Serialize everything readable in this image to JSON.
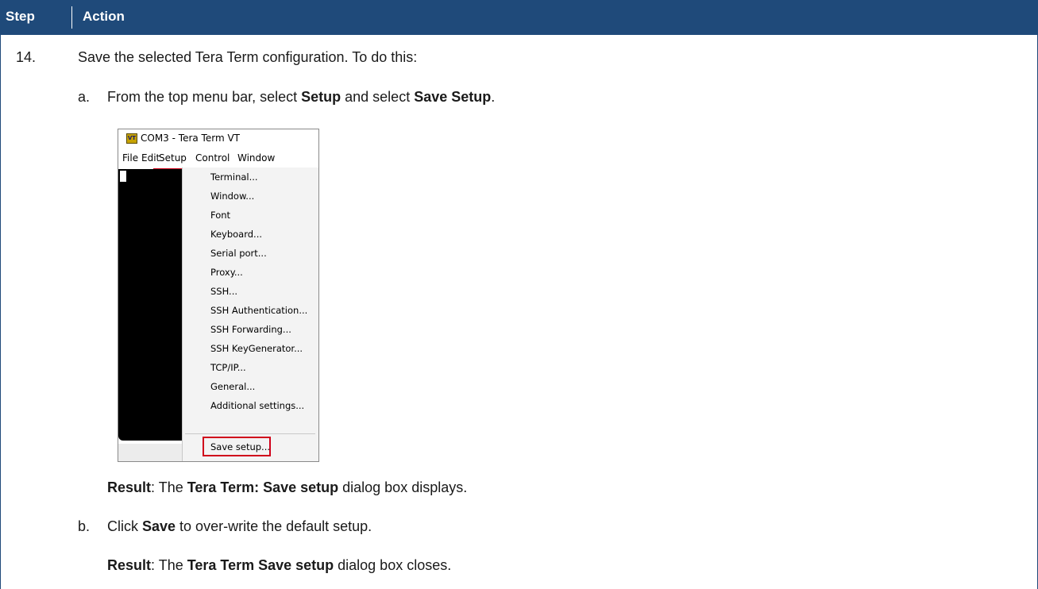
{
  "header": {
    "step_label": "Step",
    "action_label": "Action"
  },
  "step": {
    "number": "14.",
    "intro": "Save the selected Tera Term configuration. To do this:",
    "substeps": [
      {
        "letter": "a.",
        "t1": "From the top menu bar, select ",
        "b1": "Setup",
        "t2": " and select ",
        "b2": "Save Setup",
        "t3": ".",
        "result_label": "Result",
        "result_t1": ": The ",
        "result_b1": "Tera Term: Save setup",
        "result_t2": " dialog box displays."
      },
      {
        "letter": "b.",
        "t1": "Click ",
        "b1": "Save",
        "t2": " to over-write the default setup.",
        "result_label": "Result",
        "result_t1": ": The ",
        "result_b1": "Tera Term Save setup",
        "result_t2": " dialog box closes."
      }
    ]
  },
  "screenshot": {
    "app_icon": "VT",
    "window_title": "COM3 - Tera Term VT",
    "menubar": [
      "File",
      "Edit",
      "Setup",
      "Control",
      "Window"
    ],
    "setup_menu": [
      "Terminal...",
      "Window...",
      "Font",
      "Keyboard...",
      "Serial port...",
      "Proxy...",
      "SSH...",
      "SSH Authentication...",
      "SSH Forwarding...",
      "SSH KeyGenerator...",
      "TCP/IP...",
      "General...",
      "Additional settings...",
      "Save setup..."
    ],
    "highlight_color": "#d0021b"
  },
  "colors": {
    "header_bg": "#1f4a7a",
    "header_text": "#ffffff"
  }
}
